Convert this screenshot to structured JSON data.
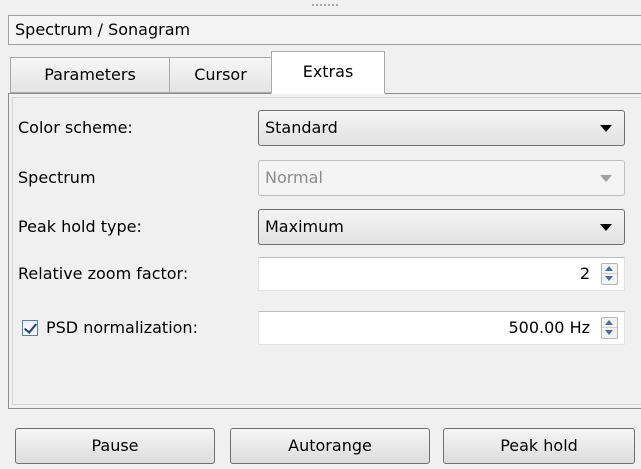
{
  "window": {
    "title": "Spectrum / Sonagram"
  },
  "tabs": [
    {
      "label": "Parameters",
      "active": false
    },
    {
      "label": "Cursor",
      "active": false
    },
    {
      "label": "Extras",
      "active": true
    }
  ],
  "extras": {
    "color_scheme": {
      "label": "Color scheme:",
      "value": "Standard"
    },
    "spectrum": {
      "label": "Spectrum",
      "value": "Normal",
      "enabled": false
    },
    "peak_hold_type": {
      "label": "Peak hold type:",
      "value": "Maximum"
    },
    "relative_zoom": {
      "label": "Relative zoom factor:",
      "value": "2"
    },
    "psd_normalization": {
      "label": "PSD normalization:",
      "value": "500.00 Hz",
      "checked": true
    }
  },
  "buttons": {
    "pause": "Pause",
    "autorange": "Autorange",
    "peak_hold": "Peak hold"
  },
  "icons": {
    "dropdown": "chevron-down-icon",
    "spin": "spin-arrows-icon",
    "check": "checkmark-icon"
  }
}
